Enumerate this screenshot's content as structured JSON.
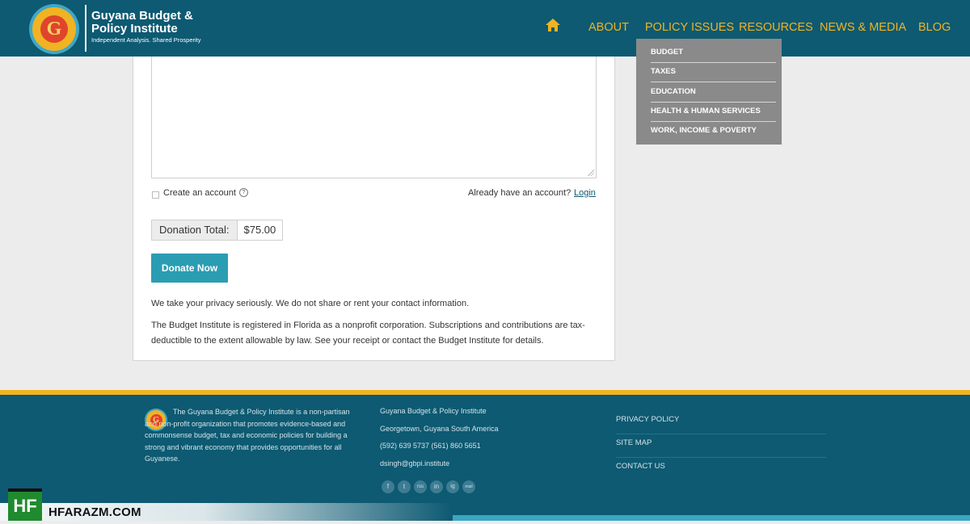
{
  "header": {
    "logo_title_line1": "Guyana Budget &",
    "logo_title_line2": "Policy Institute",
    "logo_tagline": "Independent Analysis. Shared Prosperity",
    "logo_letter": "G",
    "nav": [
      "ABOUT",
      "POLICY ISSUES",
      "RESOURCES",
      "NEWS & MEDIA",
      "BLOG"
    ]
  },
  "dropdown": {
    "items": [
      "BUDGET",
      "TAXES",
      "EDUCATION",
      "HEALTH & HUMAN SERVICES",
      "WORK, INCOME & POVERTY"
    ]
  },
  "form": {
    "create_account_label": "Create an account",
    "help_glyph": "?",
    "already_text": "Already have an account?",
    "login_link": "Login",
    "donation_total_label": "Donation Total:",
    "donation_total_value": "$75.00",
    "donate_button": "Donate Now",
    "privacy_text": "We take your privacy seriously. We do not share or rent your contact information.",
    "registered_text": "The Budget Institute is registered in Florida as a nonprofit corporation. Subscriptions and contributions are tax-deductible to the extent allowable by law. See your receipt or contact the Budget Institute for details."
  },
  "footer": {
    "about": "The Guyana Budget & Policy Institute is a non-partisan and non-profit organization that promotes evidence-based and commonsense budget, tax and economic policies for building a strong and vibrant economy that provides opportunities for all Guyanese.",
    "contact": [
      "Guyana Budget & Policy Institute",
      "Georgetown, Guyana South America",
      "(592) 639 5737 (561) 860 5651",
      "dsingh@gbpi.institute"
    ],
    "social": [
      "f",
      "t",
      "rss",
      "in",
      "ig",
      "mail"
    ],
    "links": [
      "PRIVACY POLICY",
      "SITE MAP",
      "CONTACT US"
    ]
  },
  "watermark": {
    "badge": "HF",
    "text": "HFARAZM.COM"
  },
  "colors": {
    "header_bg": "#0d5a72",
    "accent_gold": "#f0b323",
    "button_teal": "#2a9db3",
    "dropdown_bg": "#8a8a8a"
  }
}
